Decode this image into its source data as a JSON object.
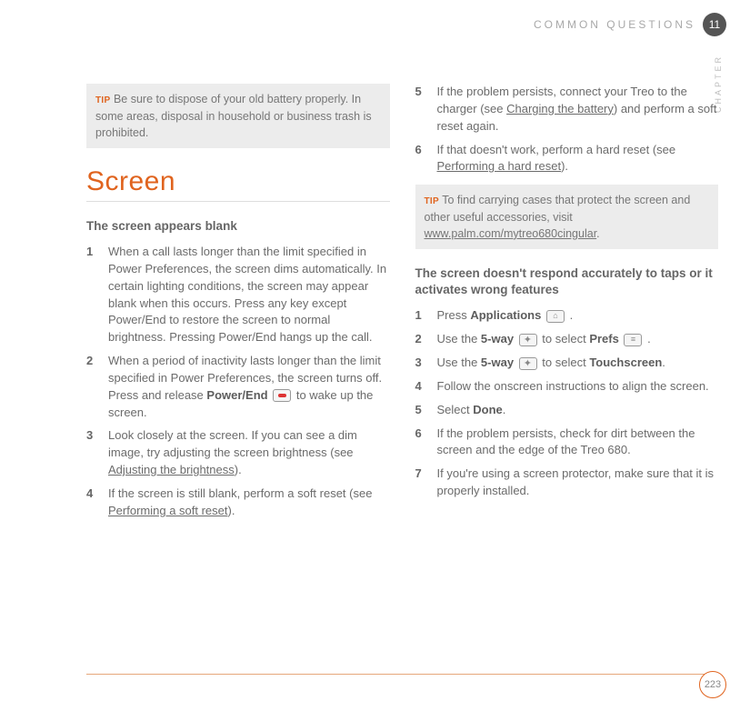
{
  "header": {
    "section": "COMMON QUESTIONS",
    "chapter_num": "11",
    "side_label": "CHAPTER"
  },
  "left": {
    "tip_label": "TIP",
    "tip_text": "Be sure to dispose of your old battery properly. In some areas, disposal in household or business trash is prohibited.",
    "heading": "Screen",
    "subhead": "The screen appears blank",
    "items": [
      {
        "n": "1",
        "t": "When a call lasts longer than the limit specified in Power Preferences, the screen dims automatically. In certain lighting conditions, the screen may appear blank when this occurs. Press any key except Power/End to restore the screen to normal brightness. Pressing Power/End hangs up the call."
      },
      {
        "n": "2",
        "pre": "When a period of inactivity lasts longer than the limit specified in Power Preferences, the screen turns off. Press and release ",
        "bold": "Power/End",
        "icon": "power",
        "post": " to wake up the screen."
      },
      {
        "n": "3",
        "pre": "Look closely at the screen. If you can see a dim image, try adjusting the screen brightness (see ",
        "link": "Adjusting the brightness",
        "post": ")."
      },
      {
        "n": "4",
        "pre": "If the screen is still blank, perform a soft reset (see ",
        "link": "Performing a soft reset",
        "post": ")."
      }
    ]
  },
  "right": {
    "top_items": [
      {
        "n": "5",
        "pre": "If the problem persists, connect your Treo to the charger (see ",
        "link": "Charging the battery",
        "post": ") and perform a soft reset again."
      },
      {
        "n": "6",
        "pre": "If that doesn't work, perform a hard reset (see ",
        "link": "Performing a hard reset",
        "post": ")."
      }
    ],
    "tip_label": "TIP",
    "tip_pre": "To find carrying cases that protect the screen and other useful accessories, visit ",
    "tip_link": "www.palm.com/mytreo680cingular",
    "tip_post": ".",
    "subhead": "The screen doesn't respond accurately to taps or it activates wrong features",
    "items": [
      {
        "n": "1",
        "pre": "Press ",
        "bold": "Applications",
        "icon": "home",
        "post": " ."
      },
      {
        "n": "2",
        "pre": "Use the ",
        "bold": "5-way",
        "icon": "5way",
        "mid": " to select ",
        "bold2": "Prefs",
        "icon2": "prefs",
        "post": " ."
      },
      {
        "n": "3",
        "pre": "Use the ",
        "bold": "5-way",
        "icon": "5way",
        "mid": " to select ",
        "bold2": "Touchscreen",
        "post": "."
      },
      {
        "n": "4",
        "t": "Follow the onscreen instructions to align the screen."
      },
      {
        "n": "5",
        "pre": "Select ",
        "bold": "Done",
        "post": "."
      },
      {
        "n": "6",
        "t": "If the problem persists, check for dirt between the screen and the edge of the Treo 680."
      },
      {
        "n": "7",
        "t": "If you're using a screen protector, make sure that it is properly installed."
      }
    ]
  },
  "footer": {
    "page": "223"
  }
}
